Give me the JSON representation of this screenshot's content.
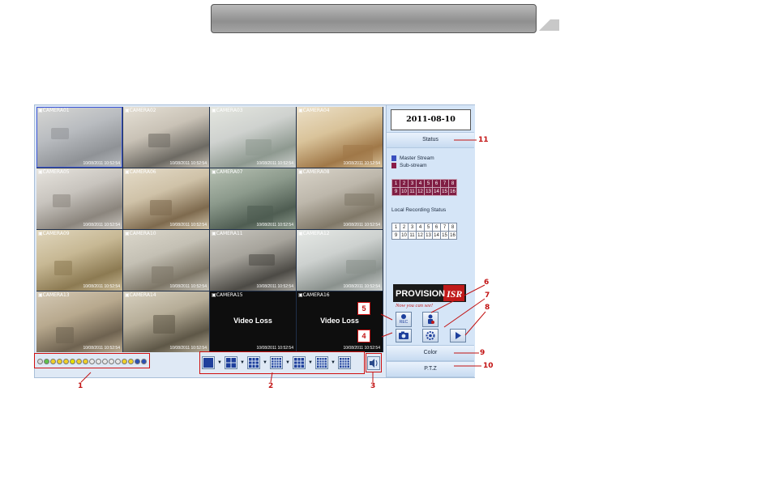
{
  "datetime": "2011-08-10 10:52:54",
  "status_label": "Status",
  "legend": {
    "master": "Master Stream",
    "sub": "Sub-stream",
    "master_color": "#3a4fbf",
    "sub_color": "#8a1c48"
  },
  "channels_row1": [
    "1",
    "2",
    "3",
    "4",
    "5",
    "6",
    "7",
    "8"
  ],
  "channels_row2": [
    "9",
    "10",
    "11",
    "12",
    "13",
    "14",
    "15",
    "16"
  ],
  "local_recording_label": "Local Recording Status",
  "logo": {
    "brand": "PROVISION ISR",
    "tagline": "Now you can see!"
  },
  "buttons": {
    "rec": "REC",
    "snapshot": "camera-icon",
    "audio": "person-icon",
    "settings": "gear-icon",
    "playback": "play-icon"
  },
  "color_label": "Color",
  "ptz_label": "P.T.Z",
  "cameras": [
    {
      "name": "CAMERA01",
      "timestamp": "10/08/2011 10:52:54",
      "kind": "feed",
      "scene": "lobby"
    },
    {
      "name": "CAMERA02",
      "timestamp": "10/08/2011 10:52:54",
      "kind": "feed",
      "scene": "office"
    },
    {
      "name": "CAMERA03",
      "timestamp": "10/08/2011 10:52:54",
      "kind": "feed",
      "scene": "open-office"
    },
    {
      "name": "CAMERA04",
      "timestamp": "10/08/2011 10:52:54",
      "kind": "feed",
      "scene": "reception"
    },
    {
      "name": "CAMERA05",
      "timestamp": "10/08/2011 10:52:54",
      "kind": "feed",
      "scene": "corridor"
    },
    {
      "name": "CAMERA06",
      "timestamp": "10/08/2011 10:52:54",
      "kind": "feed",
      "scene": "meeting"
    },
    {
      "name": "CAMERA07",
      "timestamp": "10/08/2011 10:52:54",
      "kind": "feed",
      "scene": "hall"
    },
    {
      "name": "CAMERA08",
      "timestamp": "10/08/2011 10:52:54",
      "kind": "feed",
      "scene": "room"
    },
    {
      "name": "CAMERA09",
      "timestamp": "10/08/2011 10:52:54",
      "kind": "feed",
      "scene": "warehouse"
    },
    {
      "name": "CAMERA10",
      "timestamp": "10/08/2011 10:52:54",
      "kind": "feed",
      "scene": "storage"
    },
    {
      "name": "CAMERA11",
      "timestamp": "10/08/2011 10:52:54",
      "kind": "feed",
      "scene": "parking"
    },
    {
      "name": "CAMERA12",
      "timestamp": "10/08/2011 10:52:54",
      "kind": "feed",
      "scene": "lab"
    },
    {
      "name": "CAMERA13",
      "timestamp": "10/08/2011 10:52:54",
      "kind": "feed",
      "scene": "door"
    },
    {
      "name": "CAMERA14",
      "timestamp": "10/08/2011 10:52:54",
      "kind": "feed",
      "scene": "gate"
    },
    {
      "name": "CAMERA15",
      "timestamp": "10/08/2011 10:52:54",
      "kind": "loss",
      "loss_text": "Video Loss"
    },
    {
      "name": "CAMERA16",
      "timestamp": "10/08/2011 10:52:54",
      "kind": "loss",
      "loss_text": "Video Loss"
    }
  ],
  "channel_dots": [
    "#d8d8d8",
    "#5fc24a",
    "#f0d028",
    "#f0d028",
    "#f0d028",
    "#e6e000",
    "#f0d028",
    "#f0d028",
    "#e8e8e8",
    "#e8e8e8",
    "#e8e8e8",
    "#e8e8e8",
    "#e8e8e8",
    "#f0d028",
    "#f0d028",
    "#2a4fb5",
    "#2a4fb5"
  ],
  "layouts": [
    "1x1",
    "2x2",
    "1+5",
    "1+7",
    "3x3",
    "4x4",
    "5x5"
  ],
  "callouts": {
    "n1": "1",
    "n2": "2",
    "n3": "3",
    "n4": "4",
    "n5": "5",
    "n6": "6",
    "n7": "7",
    "n8": "8",
    "n9": "9",
    "n10": "10",
    "n11": "11"
  }
}
